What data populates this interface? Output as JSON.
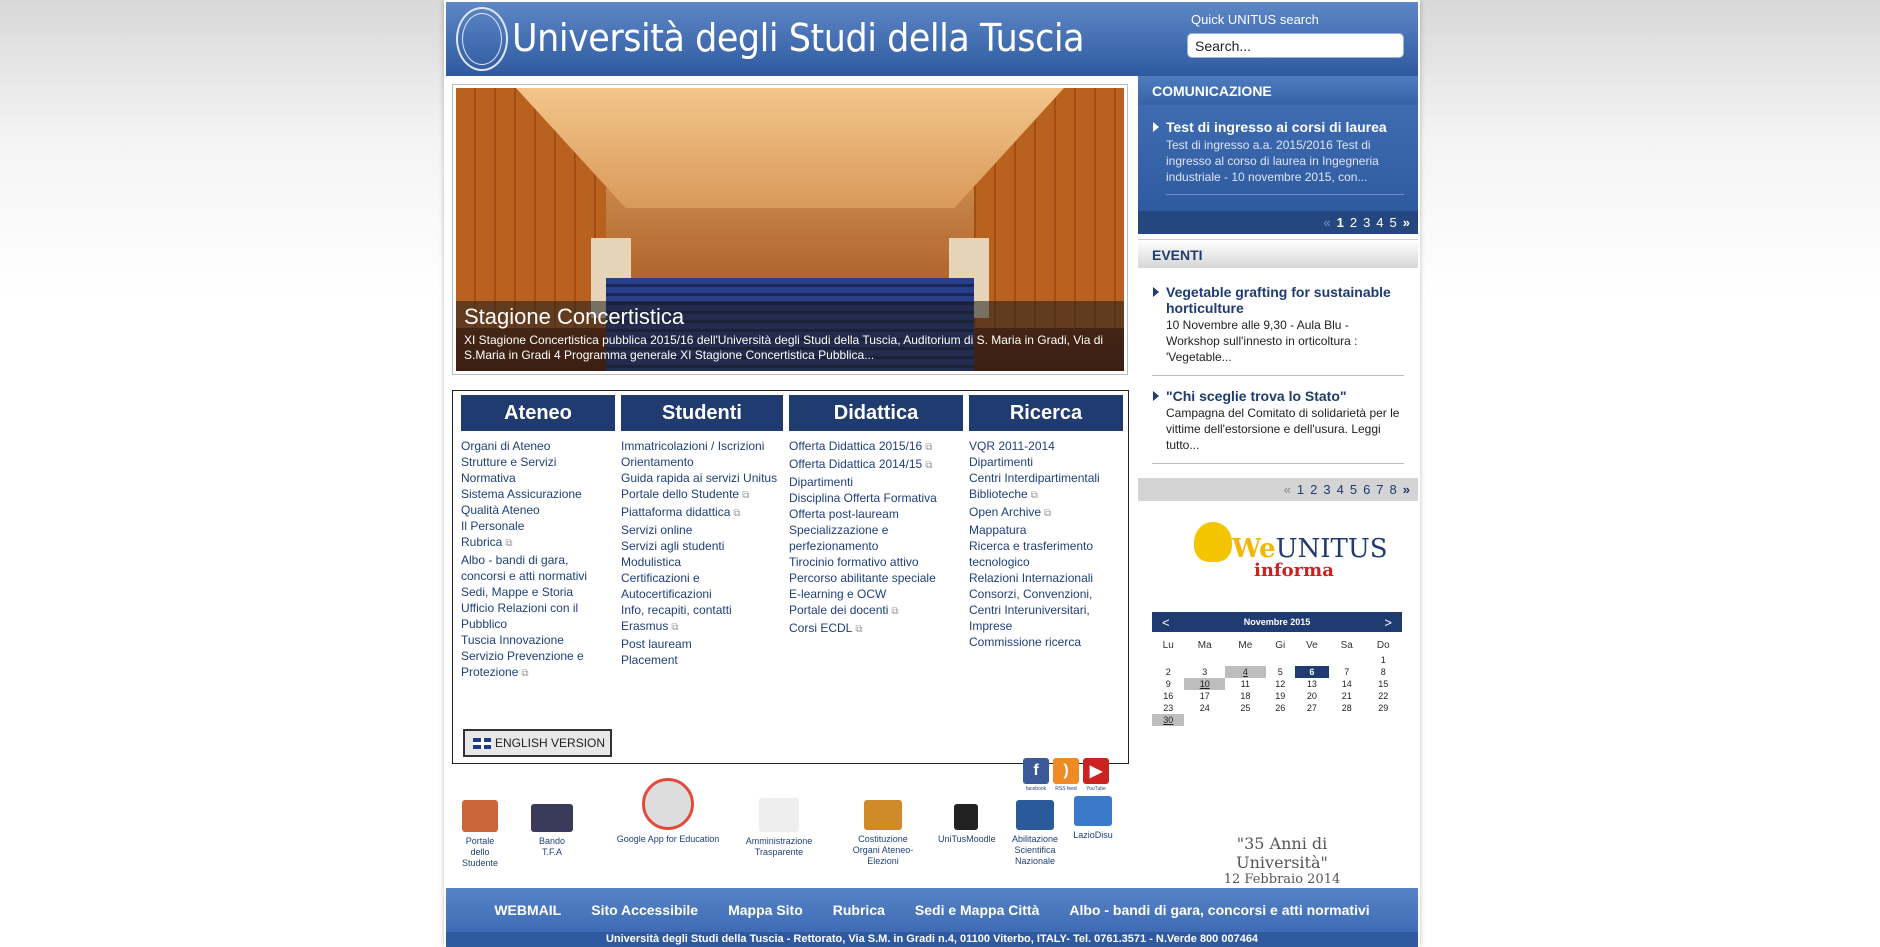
{
  "header": {
    "site_title": "Università degli Studi della Tuscia",
    "search_label": "Quick UNITUS search",
    "search_placeholder": "Search..."
  },
  "banner": {
    "title": "Stagione Concertistica",
    "text": "XI Stagione Concertistica pubblica 2015/16 dell'Università degli Studi della Tuscia, Auditorium di S. Maria in Gradi, Via di S.Maria in Gradi 4 Programma generale XI Stagione Concertistica Pubblica..."
  },
  "menus": [
    {
      "head": "Ateneo",
      "items": [
        {
          "label": "Organi di Ateneo",
          "ext": false
        },
        {
          "label": "Strutture e Servizi",
          "ext": false
        },
        {
          "label": "Normativa",
          "ext": false
        },
        {
          "label": "Sistema Assicurazione Qualità Ateneo",
          "ext": false
        },
        {
          "label": "Il Personale",
          "ext": false
        },
        {
          "label": "Rubrica",
          "ext": true
        },
        {
          "label": "Albo - bandi di gara, concorsi e atti normativi",
          "ext": false
        },
        {
          "label": "Sedi, Mappe e Storia",
          "ext": false
        },
        {
          "label": "Ufficio Relazioni con il Pubblico",
          "ext": false
        },
        {
          "label": "Tuscia Innovazione",
          "ext": false
        },
        {
          "label": "Servizio Prevenzione e Protezione",
          "ext": true
        }
      ]
    },
    {
      "head": "Studenti",
      "items": [
        {
          "label": "Immatricolazioni / Iscrizioni",
          "ext": false
        },
        {
          "label": "Orientamento",
          "ext": false
        },
        {
          "label": "Guida rapida ai servizi Unitus",
          "ext": false
        },
        {
          "label": "Portale dello Studente",
          "ext": true
        },
        {
          "label": "Piattaforma didattica",
          "ext": true
        },
        {
          "label": "Servizi online",
          "ext": false
        },
        {
          "label": "Servizi agli studenti",
          "ext": false
        },
        {
          "label": "Modulistica",
          "ext": false
        },
        {
          "label": "Certificazioni e Autocertificazioni",
          "ext": false
        },
        {
          "label": "Info, recapiti, contatti",
          "ext": false
        },
        {
          "label": "Erasmus",
          "ext": true
        },
        {
          "label": "Post lauream",
          "ext": false
        },
        {
          "label": "Placement",
          "ext": false
        }
      ]
    },
    {
      "head": "Didattica",
      "items": [
        {
          "label": "Offerta Didattica 2015/16",
          "ext": true
        },
        {
          "label": "Offerta Didattica 2014/15",
          "ext": true
        },
        {
          "label": "Dipartimenti",
          "ext": false
        },
        {
          "label": "Disciplina Offerta Formativa",
          "ext": false
        },
        {
          "label": "Offerta post-lauream",
          "ext": false
        },
        {
          "label": "Specializzazione e perfezionamento",
          "ext": false
        },
        {
          "label": "Tirocinio formativo attivo",
          "ext": false
        },
        {
          "label": "Percorso abilitante speciale",
          "ext": false
        },
        {
          "label": "E-learning e OCW",
          "ext": false
        },
        {
          "label": "Portale dei docenti",
          "ext": true
        },
        {
          "label": "Corsi ECDL",
          "ext": true
        }
      ]
    },
    {
      "head": "Ricerca",
      "items": [
        {
          "label": "VQR 2011-2014",
          "ext": false
        },
        {
          "label": "Dipartimenti",
          "ext": false
        },
        {
          "label": "Centri Interdipartimentali",
          "ext": false
        },
        {
          "label": "Biblioteche",
          "ext": true
        },
        {
          "label": "Open Archive",
          "ext": true
        },
        {
          "label": "Mappatura",
          "ext": false
        },
        {
          "label": "Ricerca e trasferimento tecnologico",
          "ext": false
        },
        {
          "label": "Relazioni Internazionali",
          "ext": false
        },
        {
          "label": "Consorzi, Convenzioni, Centri Interuniversitari, Imprese",
          "ext": false
        },
        {
          "label": "Commissione ricerca",
          "ext": false
        }
      ]
    }
  ],
  "english_version": "ENGLISH VERSION",
  "quick_links": [
    {
      "label": "Portale dello Studente",
      "icon": "students-icon",
      "color": "#c9673a"
    },
    {
      "label": "Bando T.F.A",
      "icon": "tfa-icon",
      "color": "#3a3a5a"
    },
    {
      "label": "Google App for Education",
      "icon": "google-apps-icon",
      "color": "#dddddd"
    },
    {
      "label": "Amministrazione Trasparente",
      "icon": "amministrazione-icon",
      "color": "#eeeeee"
    },
    {
      "label": "Costituzione Organi Ateneo-Elezioni",
      "icon": "elezioni-icon",
      "color": "#d08a2a"
    },
    {
      "label": "UniTusMoodle",
      "icon": "moodle-icon",
      "color": "#222222"
    },
    {
      "label": "Abilitazione Scientifica Nazionale",
      "icon": "asn-icon",
      "color": "#2b5a9a"
    },
    {
      "label": "LazioDisu",
      "icon": "laziodisu-icon",
      "color": "#3a7ac8"
    }
  ],
  "comunicazione": {
    "head": "COMUNICAZIONE",
    "title": "Test di ingresso ai corsi di laurea",
    "text": "Test di ingresso a.a. 2015/2016 Test di ingresso al corso di laurea in Ingegneria industriale -  10 novembre 2015, con...",
    "pages": [
      "1",
      "2",
      "3",
      "4",
      "5"
    ],
    "prev": "«",
    "next": "»"
  },
  "eventi": {
    "head": "EVENTI",
    "items": [
      {
        "title": "Vegetable grafting for sustainable horticulture",
        "text": "10 Novembre alle 9,30 - Aula Blu - Workshop sull'innesto in orticoltura : 'Vegetable..."
      },
      {
        "title": "\"Chi sceglie trova lo Stato\"",
        "text": "Campagna del Comitato di solidarietà per le vittime dell'estorsione e dell'usura. Leggi tutto..."
      }
    ],
    "pages": [
      "1",
      "2",
      "3",
      "4",
      "5",
      "6",
      "7",
      "8"
    ],
    "prev": "«",
    "next": "»"
  },
  "weunitus": {
    "we": "We",
    "unitus": "UNITUS",
    "sub": "informa"
  },
  "calendar": {
    "month": "Novembre 2015",
    "prev": "<",
    "next": ">",
    "days": [
      "Lu",
      "Ma",
      "Me",
      "Gi",
      "Ve",
      "Sa",
      "Do"
    ],
    "weeks": [
      [
        "",
        "",
        "",
        "",
        "",
        "",
        "1"
      ],
      [
        "2",
        "3",
        "4",
        "5",
        "6",
        "7",
        "8"
      ],
      [
        "9",
        "10",
        "11",
        "12",
        "13",
        "14",
        "15"
      ],
      [
        "16",
        "17",
        "18",
        "19",
        "20",
        "21",
        "22"
      ],
      [
        "23",
        "24",
        "25",
        "26",
        "27",
        "28",
        "29"
      ],
      [
        "30",
        "",
        "",
        "",
        "",
        "",
        ""
      ]
    ]
  },
  "social": [
    {
      "label": "facebook",
      "icon": "facebook-icon",
      "glyph": "f",
      "color": "#3b5998"
    },
    {
      "label": "RSS feed",
      "icon": "rss-icon",
      "glyph": ")",
      "color": "#f08a24"
    },
    {
      "label": "YouTube",
      "icon": "youtube-icon",
      "glyph": "▶",
      "color": "#cc2222"
    }
  ],
  "anniversary": {
    "line1": "\"35 Anni di Università\"",
    "line2": "12 Febbraio 2014"
  },
  "footer_nav": [
    "WEBMAIL",
    "Sito Accessibile",
    "Mappa Sito",
    "Rubrica",
    "Sedi e Mappa Città",
    "Albo - bandi di gara, concorsi e atti normativi"
  ],
  "footer_address": "Università degli Studi della Tuscia - Rettorato, Via S.M. in Gradi n.4, 01100 Viterbo,  ITALY-  Tel. 0761.3571 -  N.Verde 800 007464"
}
